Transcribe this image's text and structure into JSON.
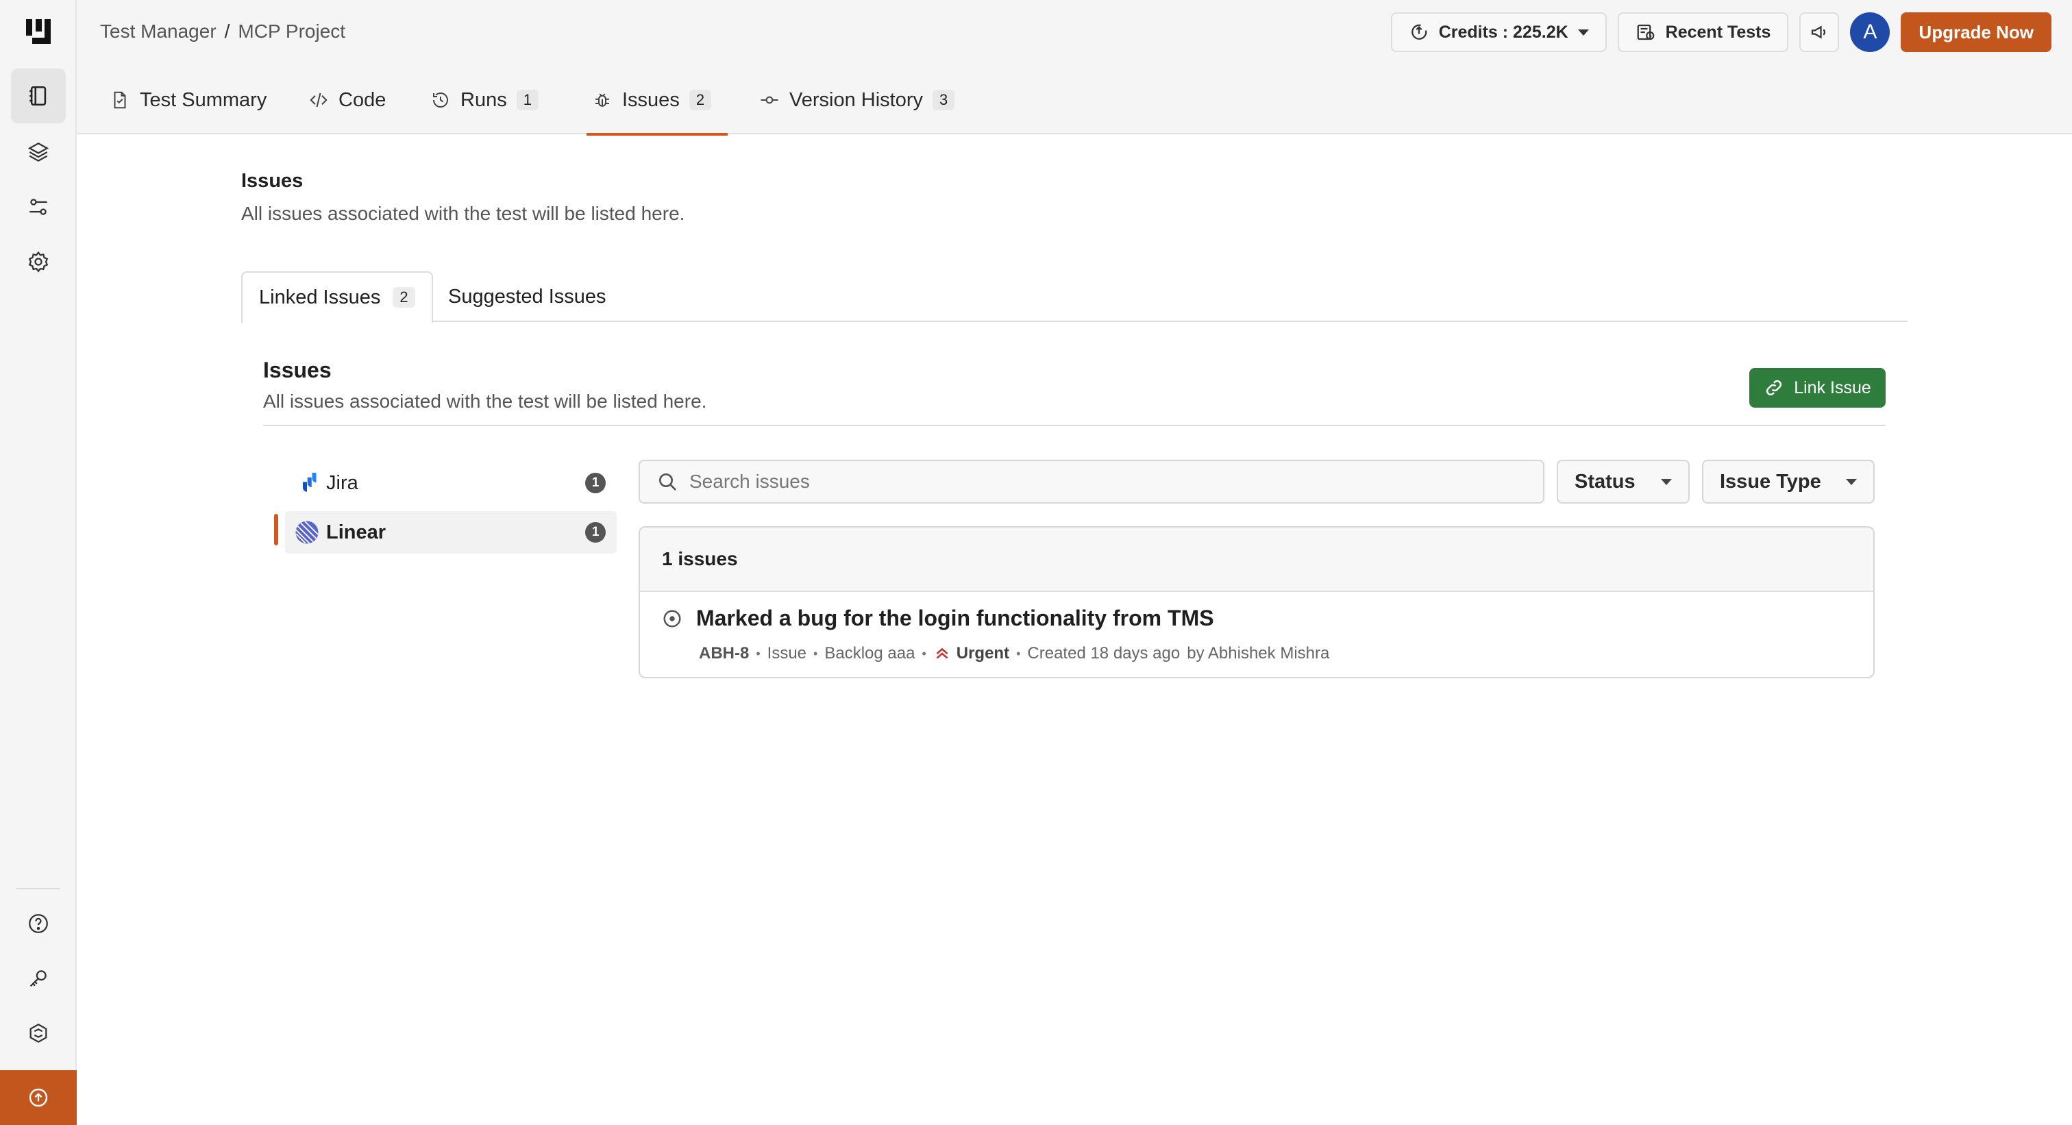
{
  "breadcrumb": {
    "parent": "Test Manager",
    "separator": "/",
    "current": "MCP Project"
  },
  "topbar": {
    "credits_label": "Credits : 225.2K",
    "recent_tests_label": "Recent Tests",
    "avatar_initial": "A",
    "upgrade_label": "Upgrade Now"
  },
  "tabs": [
    {
      "label": "Test Summary",
      "count": ""
    },
    {
      "label": "Code",
      "count": ""
    },
    {
      "label": "Runs",
      "count": "1"
    },
    {
      "label": "Issues",
      "count": "2"
    },
    {
      "label": "Version History",
      "count": "3"
    }
  ],
  "main": {
    "title": "Issues",
    "description": "All issues associated with the test will be listed here."
  },
  "subtabs": [
    {
      "label": "Linked Issues",
      "count": "2"
    },
    {
      "label": "Suggested Issues",
      "count": ""
    }
  ],
  "panel": {
    "title": "Issues",
    "description": "All issues associated with the test will be listed here.",
    "link_button_label": "Link Issue"
  },
  "integrations": [
    {
      "label": "Jira",
      "count": "1"
    },
    {
      "label": "Linear",
      "count": "1"
    }
  ],
  "search": {
    "placeholder": "Search issues",
    "value": ""
  },
  "filters": {
    "status_label": "Status",
    "issue_type_label": "Issue Type"
  },
  "issues_list": {
    "header": "1 issues",
    "items": [
      {
        "title": "Marked a bug for the login functionality from TMS",
        "key": "ABH-8",
        "type": "Issue",
        "state": "Backlog aaa",
        "priority": "Urgent",
        "created": "Created 18 days ago",
        "author": "by Abhishek Mishra"
      }
    ]
  },
  "colors": {
    "accent": "#d1581f",
    "upgrade": "#c2561d",
    "link_button": "#2f7d3c",
    "avatar": "#1f4aa8"
  }
}
